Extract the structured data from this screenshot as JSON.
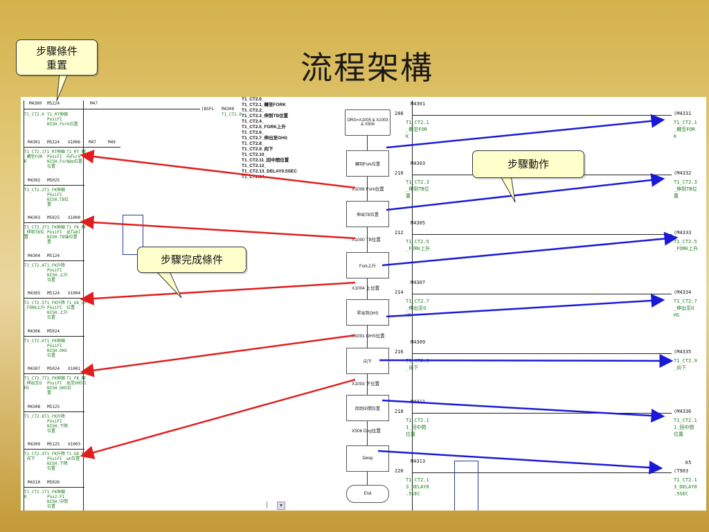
{
  "title": "流程架構",
  "callouts": {
    "reset": [
      "步驟條件",
      "重置"
    ],
    "action": "步驟動作",
    "complete": "步驟完成條件"
  },
  "step_list": [
    "T1_CT2.0_",
    "T1_CT2.1_轉至FORK",
    "T1_CT2.2_",
    "T1_CT2.3_伸到TB位置",
    "T1_CT2.4_",
    "T1_CT2.5_FORK上升",
    "T1_CT2.6_",
    "T1_CT2.7_伸出至OHS",
    "T1_CT2.8_",
    "T1_CT2.9_向下",
    "T1_CT2.10_",
    "T1_CT2.11_回中間位置",
    "T1_CT2.12_",
    "T1_CT2.13_DELAY0.5SEC",
    "T1_CT2.14_"
  ],
  "flowchart": {
    "start": "ORG=X1005 & X1003 & X506",
    "steps": [
      "轉到Fork位置",
      "伸出TB位置",
      "Fork上升",
      "昇出到OHS",
      "向下",
      "回到中間位置",
      "Delay"
    ],
    "transitions": [
      "X1006 Fork位置",
      "X1000 TB位置",
      "X1004 上位置",
      "X1001 OHS位置",
      "X1003 下位置",
      "X506 Dog位置"
    ],
    "end": "End"
  },
  "left_ladder": {
    "top": {
      "contact1": "M4300",
      "contact2": "M5224",
      "contact3": "M47",
      "coil": "[BSFL",
      "coil_dev": "M4300",
      "coil_note": "T1_CT2.0",
      "label": "T1_CT2.0",
      "note": "T1_RT伸縮 PosiFI NISH.Fork位置"
    },
    "rungs": [
      {
        "c1": "M4301",
        "c2": "M5224",
        "c3": "X1006",
        "c4": "M47",
        "c5": "M49",
        "l1": "T1_CT2.1",
        "l1b": "_轉至FOR",
        "l1c": "K",
        "note1": "T1_RT伸縮",
        "note2": "PosiFI",
        "note3": "NISH.Fork",
        "note4": "位置",
        "extra": "T1_RT_轉",
        "extra2": "向Fork S",
        "extra3": "ide位置"
      },
      {
        "c1": "M4302",
        "c2": "M5025",
        "c3": "",
        "l1": "T1_CT2.2",
        "note1": "T1_FK伸縮",
        "note2": "PosiFI",
        "note3": "NISH.TB位",
        "note4": "置"
      },
      {
        "c1": "M4303",
        "c2": "M5025",
        "c3": "X1000",
        "l1": "T1_CT2.3",
        "l1b": "_伸到TB位",
        "l1c": "置",
        "note1": "T1_FK伸縮",
        "note2": "PosiFI",
        "note3": "NISH.TB位",
        "note4": "置",
        "extra": "T1_FK_伸",
        "extra2": "出Tabl",
        "extra3": "e位置"
      },
      {
        "c1": "M4304",
        "c2": "M5124",
        "c3": "",
        "l1": "T1_CT2.4",
        "note1": "T1_FK升降",
        "note2": "PosiFI",
        "note3": "NISH.上升",
        "note4": "位置"
      },
      {
        "c1": "M4305",
        "c2": "M5124",
        "c3": "X1004",
        "l1": "T1_CT2.5",
        "l1b": "_FORK上升",
        "note1": "T1_FK升降",
        "note2": "PosiFI",
        "note3": "NISH.上升",
        "note4": "位置",
        "extra": "T1_UD_UP",
        "extra2": "位置"
      },
      {
        "c1": "M4306",
        "c2": "M5024",
        "c3": "",
        "l1": "T1_CT2.6",
        "note1": "T1_FK伸縮",
        "note2": "PosiFI",
        "note3": "NISH.OHS",
        "note4": "位置"
      },
      {
        "c1": "M4307",
        "c2": "M5024",
        "c3": "X1001",
        "l1": "T1_CT2.7",
        "l1b": "_伸出至O",
        "l1c": "HS",
        "note1": "T1_FK伸縮",
        "note2": "PosiFI",
        "note3": "NISH.OHS位",
        "note4": "置",
        "extra": "T1_FK_伸",
        "extra2": "出至OHS位"
      },
      {
        "c1": "M4308",
        "c2": "M5125",
        "c3": "",
        "l1": "T1_CT2.8",
        "note1": "T1_FK升降",
        "note2": "PosiFI",
        "note3": "NISH.下降",
        "note4": "位置"
      },
      {
        "c1": "M4309",
        "c2": "M5125",
        "c3": "X1003",
        "l1": "T1_CT2.9",
        "l1b": "_向下",
        "note1": "T1_FK升降",
        "note2": "PosiFI",
        "note3": "NISH.下降",
        "note4": "位置",
        "extra": "T1_UD_D",
        "extra2": "wn位置"
      },
      {
        "c1": "M4310",
        "c2": "M5026",
        "c3": "",
        "l1": "T1_CT2.1",
        "l1b": "0_",
        "note1": "T1_FK伸縮",
        "note2": "Pos2.FI",
        "note3": "NISH.中間",
        "note4": "位置"
      }
    ]
  },
  "right_ladder": {
    "rungs": [
      {
        "num": "208",
        "contact": "M4301",
        "label": "T1_CT2.1\n_轉至FOR\nK",
        "coil": "(M4331",
        "coil_label": "T1_CT2.1\n_轉至FOR\nK"
      },
      {
        "num": "210",
        "contact": "M4303",
        "label": "T1_CT2.3\n_伸到TB位\n置",
        "coil": "(M4332",
        "coil_label": "T1_CT2.3\n_伸到TB位\n置"
      },
      {
        "num": "212",
        "contact": "M4305",
        "label": "T1_CT2.5\n_FORK上升",
        "coil": "(M4333",
        "coil_label": "T1_CT2.5\n_FORK上升"
      },
      {
        "num": "214",
        "contact": "M4307",
        "label": "T1_CT2.7\n_伸出至O\nHS",
        "coil": "(M4334",
        "coil_label": "T1_CT2.7\n_伸出至O\nHS"
      },
      {
        "num": "216",
        "contact": "M4309",
        "label": "T1_CT2.9\n_向下",
        "coil": "(M4335",
        "coil_label": "T1_CT2.9\n_向下"
      },
      {
        "num": "218",
        "contact": "M4311",
        "label": "T1_CT2.1\n1_回中間\n位置",
        "coil": "(M4336",
        "coil_label": "T1_CT2.1\n1_回中間\n位置"
      },
      {
        "num": "220",
        "contact": "M4313",
        "label": "T1_CT2.1\n3_DELAY0\n.5SEC",
        "coil": "(T903",
        "coil_k": "K5",
        "coil_label": "T1_CT2.1\n3_DELAY0\n.5SEC"
      }
    ]
  },
  "colors": {
    "red_arrow": "#e11d1d",
    "blue_arrow": "#1a1ad6",
    "callout_bg": "#ffffcc"
  }
}
